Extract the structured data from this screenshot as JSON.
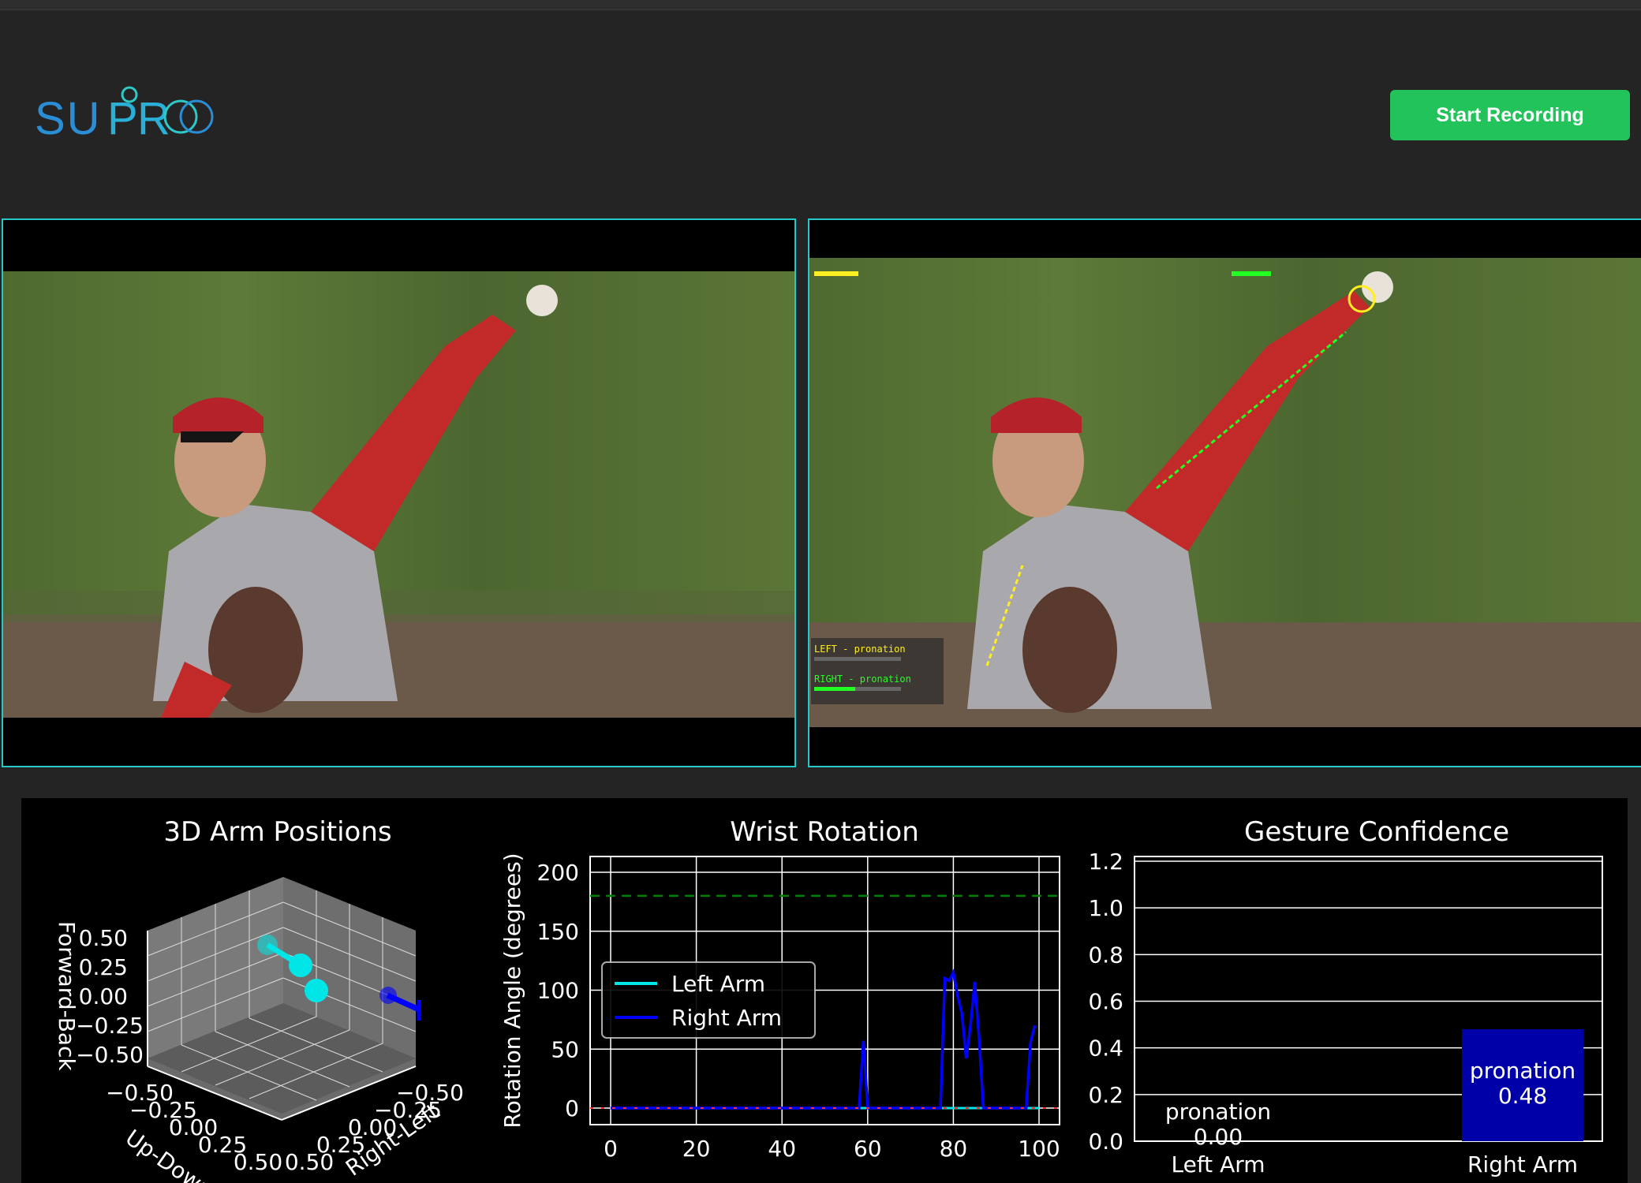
{
  "app": {
    "logo_text": "SUPRO",
    "start_recording_label": "Start Recording"
  },
  "video_left": {
    "label": "original-video-feed"
  },
  "video_right": {
    "overlay_left_label": "LEFT - pronation",
    "overlay_right_label": "RIGHT - pronation"
  },
  "colors": {
    "accent": "#27c8c8",
    "button": "#22c35a",
    "left_arm": "#00e5e5",
    "right_arm": "#0000ff"
  },
  "chart_data": [
    {
      "type": "scatter3d",
      "title": "3D Arm Positions",
      "axes": {
        "z_label": "Forward-Back",
        "x_label": "Up-Down",
        "y_label": "Right-Left"
      },
      "z_ticks": [
        "0.50",
        "0.25",
        "0.00",
        "−0.25",
        "−0.50"
      ],
      "x_ticks": [
        "−0.50",
        "−0.25",
        "0.00",
        "0.25",
        "0.50"
      ],
      "y_ticks": [
        "−0.50",
        "−0.25",
        "0.00",
        "0.25",
        "0.50"
      ],
      "series": [
        {
          "name": "Left Arm"
        },
        {
          "name": "Right Arm"
        }
      ]
    },
    {
      "type": "line",
      "title": "Wrist Rotation",
      "ylabel": "Rotation Angle (degrees)",
      "xlim": [
        0,
        100
      ],
      "ylim": [
        0,
        200
      ],
      "x_ticks": [
        "0",
        "20",
        "40",
        "60",
        "80",
        "100"
      ],
      "y_ticks": [
        "200",
        "150",
        "100",
        "50",
        "0"
      ],
      "threshold": 180,
      "legend_placement": "center-left",
      "series": [
        {
          "name": "Left Arm",
          "x": [
            0,
            100
          ],
          "y": [
            0,
            0
          ]
        },
        {
          "name": "Right Arm",
          "x": [
            0,
            58,
            59,
            60,
            77,
            78,
            79,
            80,
            81,
            82,
            83,
            84,
            85,
            86,
            87,
            97,
            98,
            99
          ],
          "y": [
            0,
            0,
            57,
            0,
            0,
            110,
            108,
            115,
            95,
            80,
            42,
            70,
            107,
            60,
            0,
            0,
            55,
            70
          ]
        }
      ]
    },
    {
      "type": "bar",
      "title": "Gesture Confidence",
      "categories": [
        "Left Arm",
        "Right Arm"
      ],
      "values": [
        0.0,
        0.48
      ],
      "bar_labels": [
        "pronation",
        "pronation"
      ],
      "value_labels": [
        "0.00",
        "0.48"
      ],
      "ylim": [
        0,
        1.2
      ],
      "y_ticks": [
        "1.2",
        "1.0",
        "0.8",
        "0.6",
        "0.4",
        "0.2",
        "0.0"
      ],
      "grid": true
    }
  ]
}
